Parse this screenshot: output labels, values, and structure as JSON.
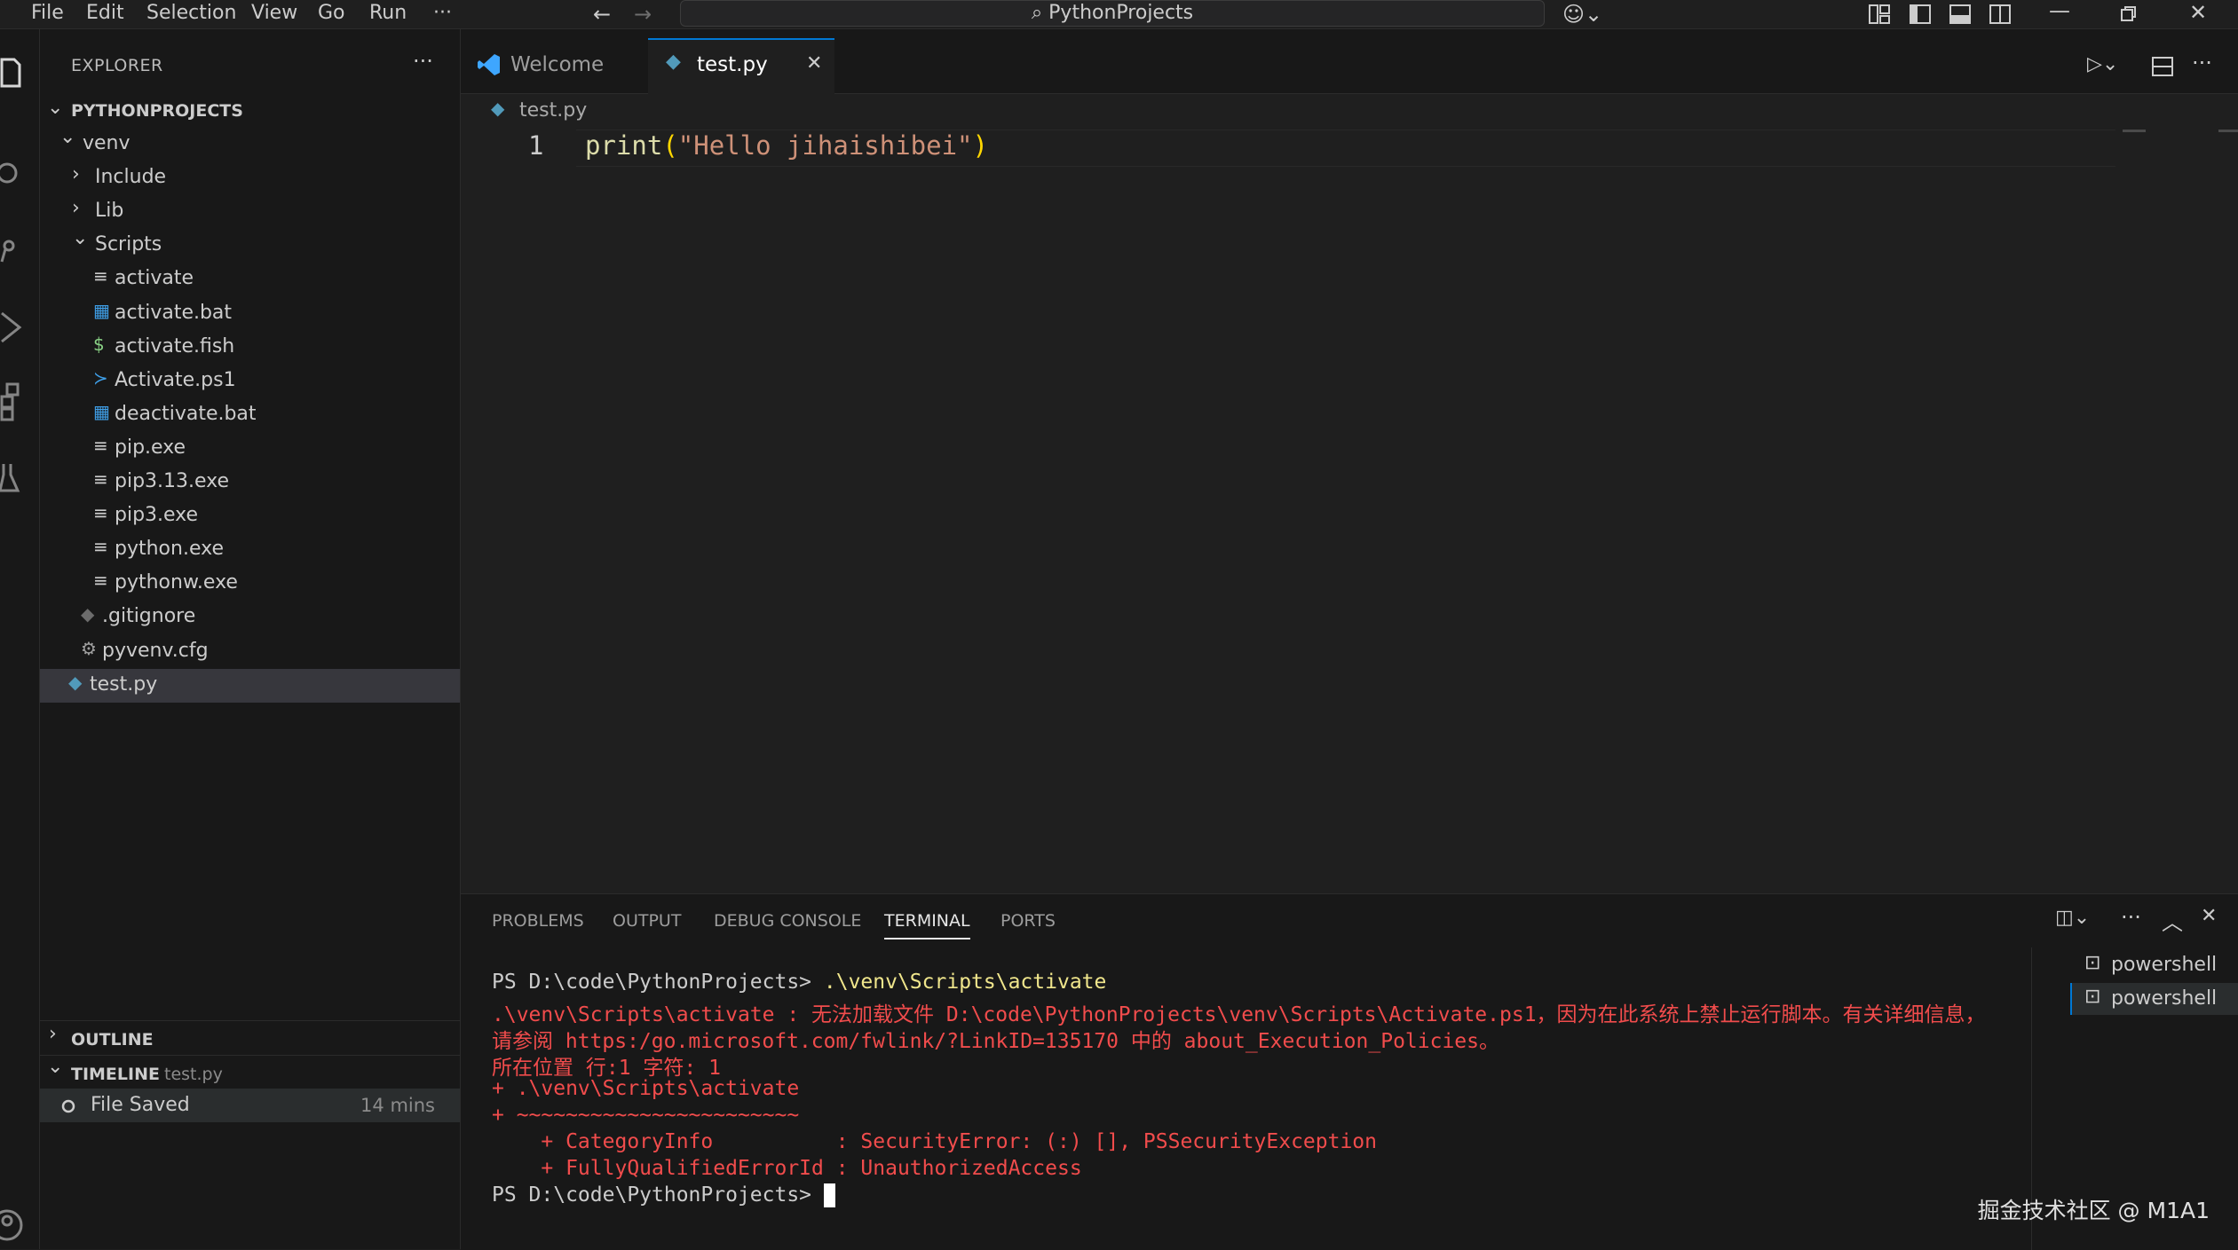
{
  "menu": [
    "File",
    "Edit",
    "Selection",
    "View",
    "Go",
    "Run",
    "···"
  ],
  "title_bar": {
    "search_text": "PythonProjects",
    "back_icon": "arrow-left-icon",
    "forward_icon": "arrow-right-icon",
    "copilot_icon": "copilot-icon",
    "layout_icons": [
      "customize-layout-icon",
      "toggle-primary-sidebar-icon",
      "toggle-panel-icon",
      "toggle-secondary-sidebar-icon"
    ],
    "window_controls": [
      "minimize-icon",
      "restore-icon",
      "close-icon"
    ]
  },
  "activity_bar": [
    "explorer-icon",
    "search-icon",
    "source-control-icon",
    "run-debug-icon",
    "extensions-icon",
    "testing-icon",
    "account-icon"
  ],
  "explorer": {
    "title": "EXPLORER",
    "more": "···",
    "root": "PYTHONPROJECTS",
    "items": [
      {
        "label": "venv",
        "depth": 1,
        "kind": "folder-open"
      },
      {
        "label": "Include",
        "depth": 2,
        "kind": "folder-closed"
      },
      {
        "label": "Lib",
        "depth": 2,
        "kind": "folder-closed"
      },
      {
        "label": "Scripts",
        "depth": 2,
        "kind": "folder-open"
      },
      {
        "label": "activate",
        "depth": 3,
        "kind": "file-text"
      },
      {
        "label": "activate.bat",
        "depth": 3,
        "kind": "file-windows"
      },
      {
        "label": "activate.fish",
        "depth": 3,
        "kind": "file-shell"
      },
      {
        "label": "Activate.ps1",
        "depth": 3,
        "kind": "file-powershell"
      },
      {
        "label": "deactivate.bat",
        "depth": 3,
        "kind": "file-windows"
      },
      {
        "label": "pip.exe",
        "depth": 3,
        "kind": "file-text"
      },
      {
        "label": "pip3.13.exe",
        "depth": 3,
        "kind": "file-text"
      },
      {
        "label": "pip3.exe",
        "depth": 3,
        "kind": "file-text"
      },
      {
        "label": "python.exe",
        "depth": 3,
        "kind": "file-text"
      },
      {
        "label": "pythonw.exe",
        "depth": 3,
        "kind": "file-text"
      },
      {
        "label": ".gitignore",
        "depth": 2,
        "kind": "file-git"
      },
      {
        "label": "pyvenv.cfg",
        "depth": 2,
        "kind": "file-config"
      },
      {
        "label": "test.py",
        "depth": 1,
        "kind": "file-python",
        "selected": true
      }
    ]
  },
  "outline": {
    "title": "OUTLINE"
  },
  "timeline": {
    "title": "TIMELINE",
    "file": "test.py",
    "entry": "File Saved",
    "time": "14 mins"
  },
  "tabs": [
    {
      "label": "Welcome",
      "icon": "vscode-logo-icon",
      "active": false
    },
    {
      "label": "test.py",
      "icon": "python-file-icon",
      "active": true,
      "close": "✕"
    }
  ],
  "breadcrumb": "test.py",
  "editor": {
    "line_number": "1",
    "code_fn": "print",
    "code_open": "(",
    "code_str": "\"Hello jihaishibei\"",
    "code_close": ")"
  },
  "panel": {
    "tabs": [
      "PROBLEMS",
      "OUTPUT",
      "DEBUG CONSOLE",
      "TERMINAL",
      "PORTS"
    ],
    "active_tab": "TERMINAL",
    "sessions": [
      "powershell",
      "powershell"
    ]
  },
  "terminal": {
    "prompt1": "PS D:\\code\\PythonProjects> ",
    "cmd1": ".\\venv\\Scripts\\activate",
    "err1": ".\\venv\\Scripts\\activate : 无法加载文件 D:\\code\\PythonProjects\\venv\\Scripts\\Activate.ps1，因为在此系统上禁止运行脚本。有关详细信息，",
    "err2": "请参阅 https:/go.microsoft.com/fwlink/?LinkID=135170 中的 about_Execution_Policies。",
    "err3": "所在位置 行:1 字符: 1",
    "err4": "+ .\\venv\\Scripts\\activate",
    "err5": "+ ~~~~~~~~~~~~~~~~~~~~~~~",
    "err6": "    + CategoryInfo          : SecurityError: (:) [], PSSecurityException",
    "err7": "    + FullyQualifiedErrorId : UnauthorizedAccess",
    "prompt2": "PS D:\\code\\PythonProjects> "
  },
  "watermark": "掘金技术社区 @ M1A1",
  "colors": {
    "accent": "#0078d4",
    "error": "#f14c4c",
    "command": "#f0e68c",
    "string": "#ce9178",
    "function": "#dcdcaa",
    "python": "#519aba"
  }
}
